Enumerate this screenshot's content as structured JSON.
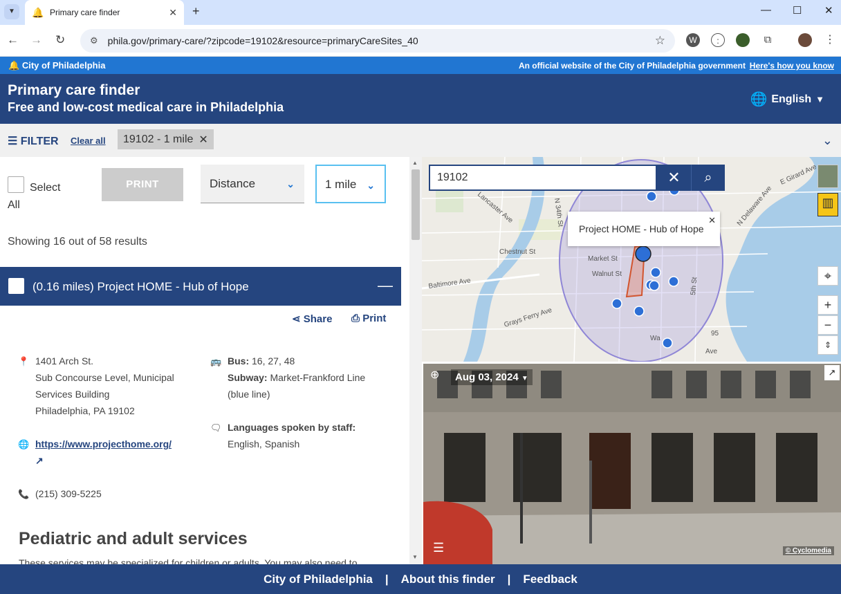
{
  "browser": {
    "tab_title": "Primary care finder",
    "url": "phila.gov/primary-care/?zipcode=19102&resource=primaryCareSites_40"
  },
  "city_band": {
    "city_name": "City of Philadelphia",
    "official_text": "An official website of the City of Philadelphia government",
    "how_link": "Here's how you know"
  },
  "header": {
    "title": "Primary care finder",
    "subtitle": "Free and low-cost medical care in Philadelphia",
    "language": "English"
  },
  "filter_bar": {
    "filter_label": "FILTER",
    "clear_all": "Clear all",
    "chip_label": "19102 - 1 mile"
  },
  "controls": {
    "select_all": "Select All",
    "print_button": "PRINT",
    "sort_value": "Distance",
    "radius_value": "1 mile"
  },
  "results": {
    "showing_text": "Showing 16 out of 58 results",
    "result_title": "(0.16 miles) Project HOME - Hub of Hope",
    "share_label": "Share",
    "print_label": "Print",
    "address": [
      "1401 Arch St.",
      "Sub Concourse Level, Municipal",
      "Services Building",
      "Philadelphia, PA 19102"
    ],
    "website": "https://www.projecthome.org/",
    "phone": "(215) 309-5225",
    "bus_label": "Bus:",
    "bus_value": "16, 27, 48",
    "subway_label": "Subway:",
    "subway_value": "Market-Frankford Line",
    "subway_note": "(blue line)",
    "languages_label": "Languages spoken by staff:",
    "languages_value": "English, Spanish",
    "services_title": "Pediatric and adult services",
    "services_text": "These services may be specialized for children or adults. You may also need to"
  },
  "map": {
    "search_value": "19102",
    "popup_text": "Project HOME - Hub of Hope",
    "street_labels": [
      "Chestnut St",
      "Market St",
      "Walnut St",
      "Baltimore Ave",
      "Grays Ferry Ave",
      "E Girard Ave",
      "N Delaware Ave",
      "N 34th St",
      "Lancaster Ave",
      "5th St",
      "Wa",
      "Ave",
      "95"
    ]
  },
  "street_view": {
    "date": "Aug 03, 2024",
    "credit": "© Cyclomedia"
  },
  "footer": {
    "links": [
      "City of Philadelphia",
      "About this finder",
      "Feedback"
    ],
    "separator": "|"
  },
  "colors": {
    "brand_dark": "#25457f",
    "brand_blue": "#2176d2",
    "map_pin": "#2d6fd6"
  }
}
